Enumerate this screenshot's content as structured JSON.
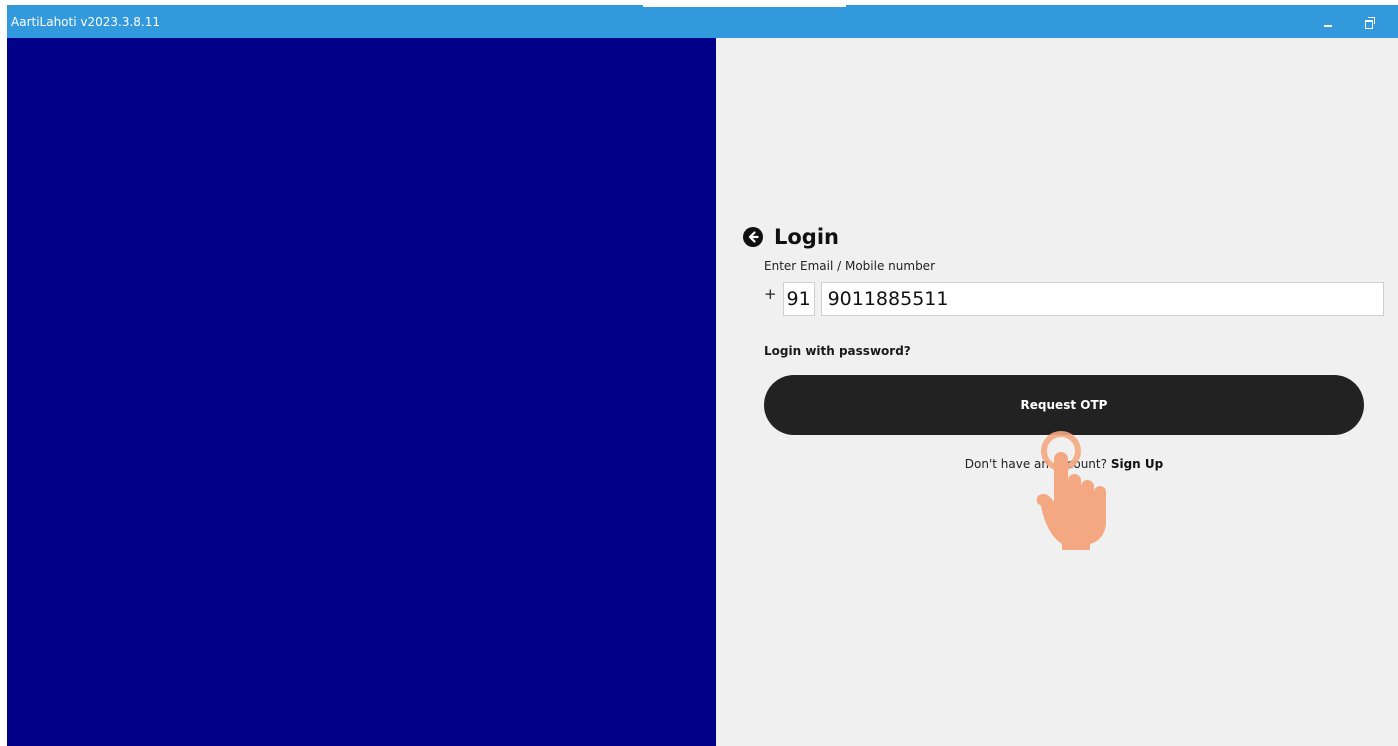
{
  "window": {
    "title": "AartiLahoti v2023.3.8.11"
  },
  "login": {
    "title": "Login",
    "field_label": "Enter Email / Mobile number",
    "plus": "+",
    "country_code": "91",
    "phone_number": "9011885511",
    "password_link": "Login with password?",
    "request_otp_label": "Request OTP",
    "signup_prompt": "Don't have an account?",
    "signup_link": "Sign Up"
  },
  "icons": {
    "back": "arrow-left-circle-icon",
    "minimize": "minimize-icon",
    "restore": "restore-icon",
    "pointer": "hand-pointer-icon"
  },
  "colors": {
    "titlebar": "#3399dd",
    "left_panel": "#000088",
    "right_panel": "#f0f0f0",
    "button": "#222222",
    "hand": "#f4a882"
  }
}
